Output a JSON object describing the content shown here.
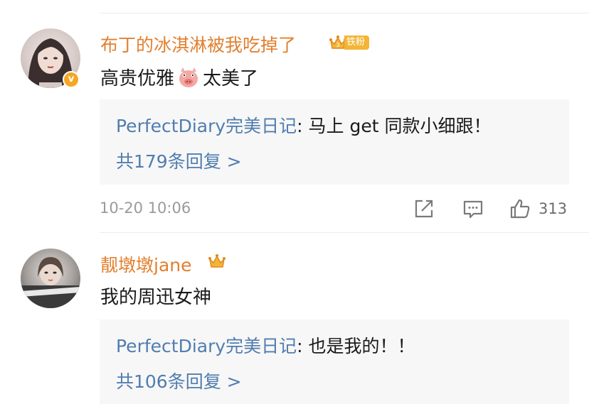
{
  "comments": [
    {
      "username": "布丁的冰淇淋被我吃掉了",
      "fan_badge": "铁粉",
      "text_before": "高贵优雅",
      "text_after": "太美了",
      "verified_mark": "v",
      "reply_author": "PerfectDiary完美日记",
      "reply_text": ": 马上 get 同款小细跟！",
      "reply_count": "共179条回复 >",
      "time": "10-20 10:06",
      "likes": "313"
    },
    {
      "username": "靓墩墩jane",
      "fan_badge": "",
      "text_before": "我的周迅女神",
      "reply_author": "PerfectDiary完美日记",
      "reply_text": ": 也是我的！！",
      "reply_count": "共106条回复 >"
    }
  ],
  "icons": {
    "share": "share-icon",
    "comment": "comment-icon",
    "like": "thumbs-up-icon",
    "crown": "crown-icon",
    "verified": "verified-badge-icon",
    "emoji": "pig-emoji-icon"
  },
  "colors": {
    "username": "#e2802f",
    "link": "#507daf",
    "reply_bg": "#f7f7f7",
    "badge": "#f3b535"
  }
}
